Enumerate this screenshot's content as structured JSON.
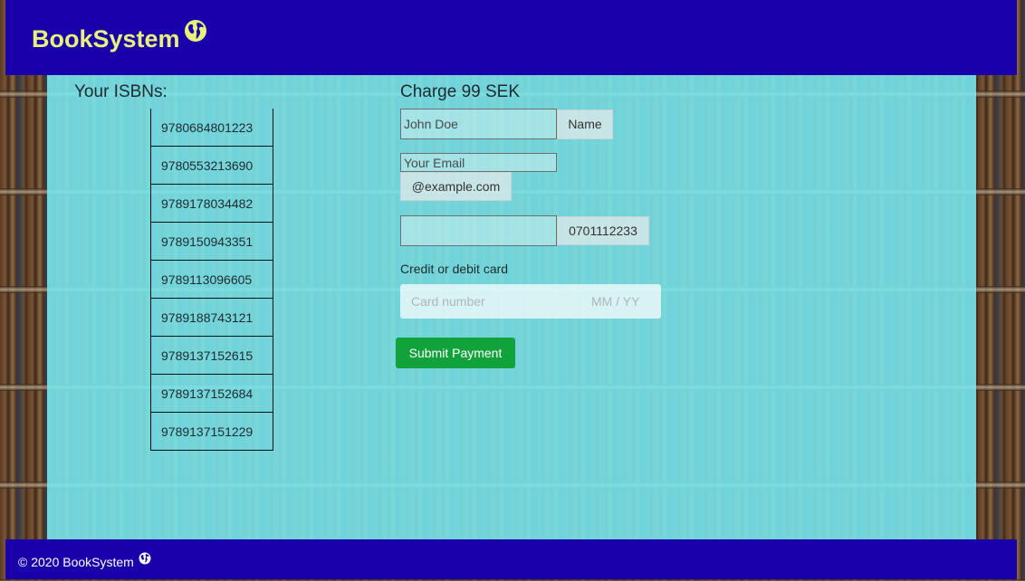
{
  "header": {
    "brand": "BookSystem",
    "brand_color": "#e8f27a",
    "bar_color": "#1a00aa"
  },
  "isbn": {
    "title": "Your ISBNs:",
    "items": [
      "9780684801223",
      "9780553213690",
      "9789178034482",
      "9789150943351",
      "9789113096605",
      "9789188743121",
      "9789137152615",
      "9789137152684",
      "9789137151229"
    ]
  },
  "payment": {
    "title": "Charge 99 SEK",
    "name_placeholder": "John Doe",
    "name_addon": "Name",
    "email_placeholder": "Your Email",
    "email_addon": "@example.com",
    "phone_placeholder": "",
    "phone_addon": "0701112233",
    "card_label": "Credit or debit card",
    "card_number_placeholder": "Card number",
    "card_expiry_placeholder": "MM / YY",
    "submit_label": "Submit Payment",
    "submit_color": "#12a23c"
  },
  "footer": {
    "text": "© 2020 BookSystem"
  },
  "icons": {
    "globe": "globe-icon"
  }
}
